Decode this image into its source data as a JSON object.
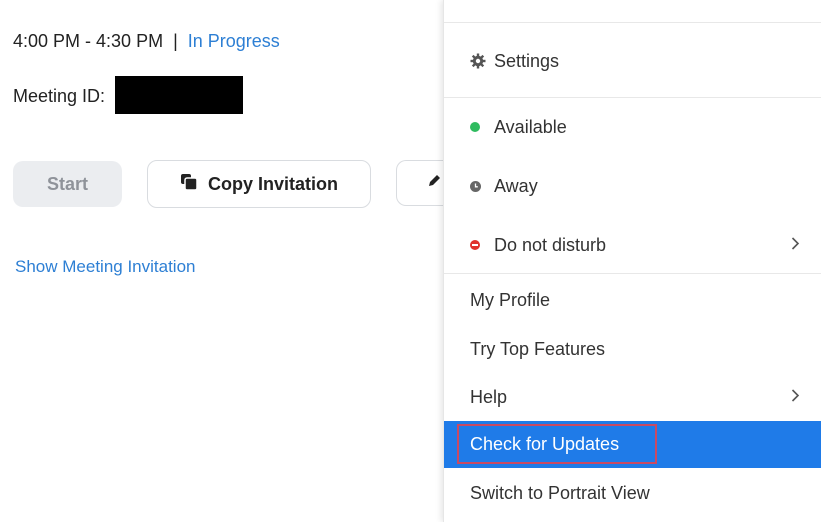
{
  "meeting": {
    "time": "4:00 PM - 4:30 PM",
    "separator": "|",
    "status": "In Progress",
    "meeting_id_label": "Meeting ID:",
    "start_label": "Start",
    "copy_invitation_label": "Copy Invitation",
    "show_invitation_link": "Show Meeting Invitation"
  },
  "menu": {
    "settings": "Settings",
    "available": "Available",
    "away": "Away",
    "do_not_disturb": "Do not disturb",
    "my_profile": "My Profile",
    "try_top_features": "Try Top Features",
    "help": "Help",
    "check_for_updates": "Check for Updates",
    "switch_portrait": "Switch to Portrait View"
  },
  "colors": {
    "link": "#2d7fd4",
    "highlight": "#1f7be8",
    "available": "#2fbb5f",
    "dnd": "#e0322b",
    "annotation_box": "#c94a63"
  },
  "icons": {
    "settings": "gear-icon",
    "copy": "copy-icon",
    "edit": "pencil-icon",
    "submenu": "chevron-right-icon"
  }
}
